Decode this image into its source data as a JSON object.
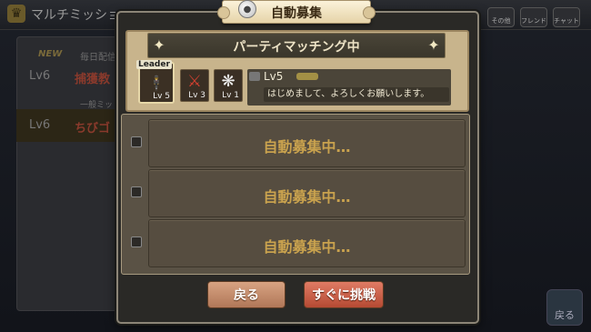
{
  "background": {
    "title": "マルチミッショ",
    "new_badge": "NEW",
    "daily_label": "毎日配信",
    "general_label": "一般ミッ",
    "missions": [
      {
        "level": "Lv6",
        "name": "捕獲教"
      },
      {
        "level": "Lv6",
        "name": "ちびゴ"
      }
    ],
    "top_buttons": [
      "その他",
      "フレンド",
      "チャット"
    ],
    "back_label": "戻る"
  },
  "dialog": {
    "title": "自動募集",
    "party_title": "パーティマッチング中",
    "leader_tag": "Leader",
    "members": [
      {
        "level": "5"
      },
      {
        "level": "3"
      },
      {
        "level": "1"
      }
    ],
    "leader_info": {
      "level": "Lv5",
      "message": "はじめまして、よろしくお願いします。"
    },
    "slots": [
      "自動募集中…",
      "自動募集中…",
      "自動募集中…"
    ],
    "buttons": {
      "back": "戻る",
      "start": "すぐに挑戦"
    }
  }
}
